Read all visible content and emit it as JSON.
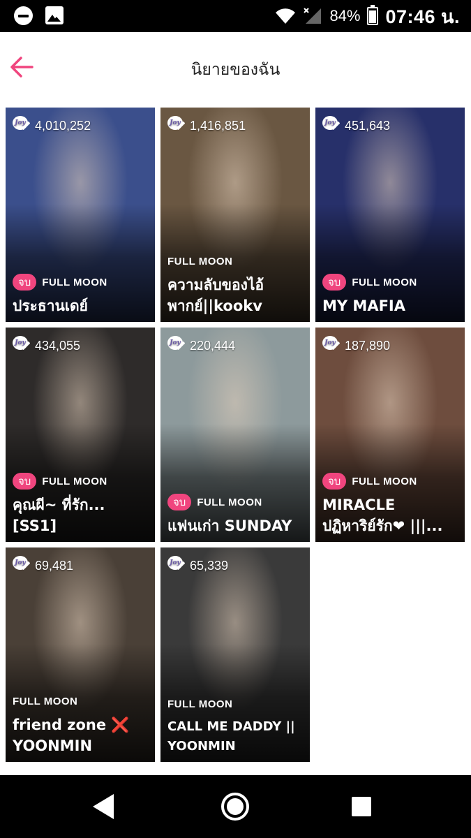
{
  "status_bar": {
    "battery": "84%",
    "battery_level": 0.84,
    "time": "07:46 น.",
    "icons": [
      "do-not-disturb-icon",
      "image-notification-icon",
      "wifi-icon",
      "signal-icon",
      "battery-icon"
    ]
  },
  "header": {
    "title": "นิยายของฉัน",
    "back_icon": "arrow-left-icon",
    "accent_color": "#f0457e"
  },
  "badge_colors": {
    "end": "#f0457e"
  },
  "novels": [
    {
      "views": "4,010,252",
      "badge": "จบ",
      "publisher": "FULL MOON",
      "title": "ประธานเดย์",
      "bg": "#3b4f8c"
    },
    {
      "views": "1,416,851",
      "badge": "",
      "publisher": "FULL MOON",
      "title": "ความลับของไอ้\nพากย์||kookv",
      "bg": "#6a5742"
    },
    {
      "views": "451,643",
      "badge": "จบ",
      "publisher": "FULL MOON",
      "title": "MY MAFIA",
      "bg": "#27306a"
    },
    {
      "views": "434,055",
      "badge": "จบ",
      "publisher": "FULL MOON",
      "title": "คุณผี~ ที่รัก...\n[SS1]",
      "bg": "#2e2b2a"
    },
    {
      "views": "220,444",
      "badge": "จบ",
      "publisher": "FULL MOON",
      "title": "แฟนเก่า SUNDAY",
      "bg": "#8d9a9c"
    },
    {
      "views": "187,890",
      "badge": "จบ",
      "publisher": "FULL MOON",
      "title": "MIRACLE\nปฏิหาริย์รัก❤ |||...",
      "bg": "#6e4d3e"
    },
    {
      "views": "69,481",
      "badge": "",
      "publisher": "FULL MOON",
      "title": "friend zone ❌\nYOONMIN",
      "bg": "#4a4037"
    },
    {
      "views": "65,339",
      "badge": "",
      "publisher": "FULL MOON",
      "title": "CALL ME DADDY ||\nYOONMIN",
      "bg": "#3a3a3a"
    }
  ],
  "nav_bar": {
    "icons": [
      "nav-back-icon",
      "nav-home-icon",
      "nav-recents-icon"
    ]
  }
}
